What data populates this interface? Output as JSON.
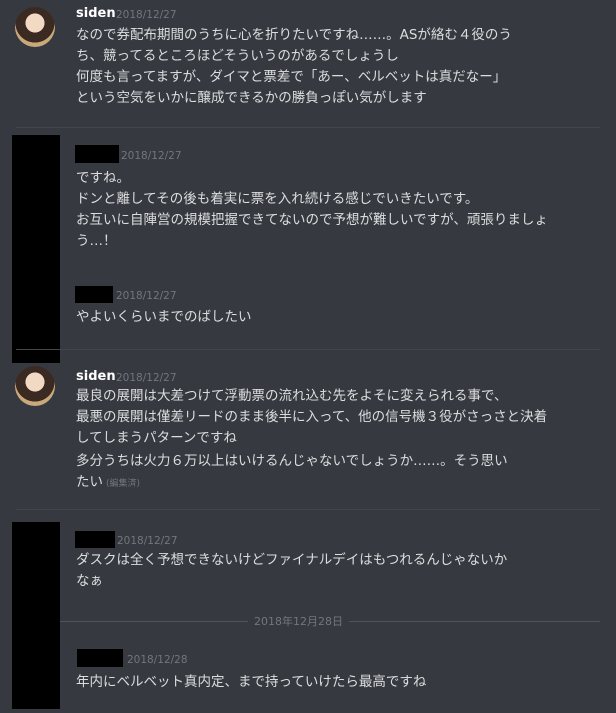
{
  "messages": [
    {
      "author": "siden",
      "timestamp": "2018/12/27",
      "lines": [
        "なので券配布期間のうちに心を折りたいですね……。ASが絡む４役のう",
        "ち、競ってるところほどそういうのがあるでしょうし",
        "何度も言ってますが、ダイマと票差で「あー、ベルベットは真だなー」",
        "という空気をいかに醸成できるかの勝負っぽい気がします"
      ]
    },
    {
      "timestamp": "2018/12/27",
      "lines": [
        "ですね。",
        "ドンと離してその後も着実に票を入れ続ける感じでいきたいです。",
        "お互いに自陣営の規模把握できてないので予想が難しいですが、頑張りましょ",
        "う…！"
      ]
    },
    {
      "timestamp": "2018/12/27",
      "lines": [
        "やよいくらいまでのばしたい"
      ]
    },
    {
      "author": "siden",
      "timestamp": "2018/12/27",
      "lines": [
        "最良の展開は大差つけて浮動票の流れ込む先をよそに変えられる事で、",
        "最悪の展開は僅差リードのまま後半に入って、他の信号機３役がさっさと決着",
        "してしまうパターンですね"
      ],
      "lines2": [
        "多分うちは火力６万以上はいけるんじゃないでしょうか……。そう思い",
        "たい"
      ],
      "edited": "(編集済)"
    },
    {
      "timestamp": "2018/12/27",
      "lines": [
        "ダスクは全く予想できないけどファイナルデイはもつれるんじゃないか",
        "なぁ"
      ]
    },
    {
      "timestamp": "2018/12/28",
      "lines": [
        "年内にベルベット真内定、まで持っていけたら最高ですね"
      ]
    }
  ],
  "date_separator": "2018年12月28日"
}
